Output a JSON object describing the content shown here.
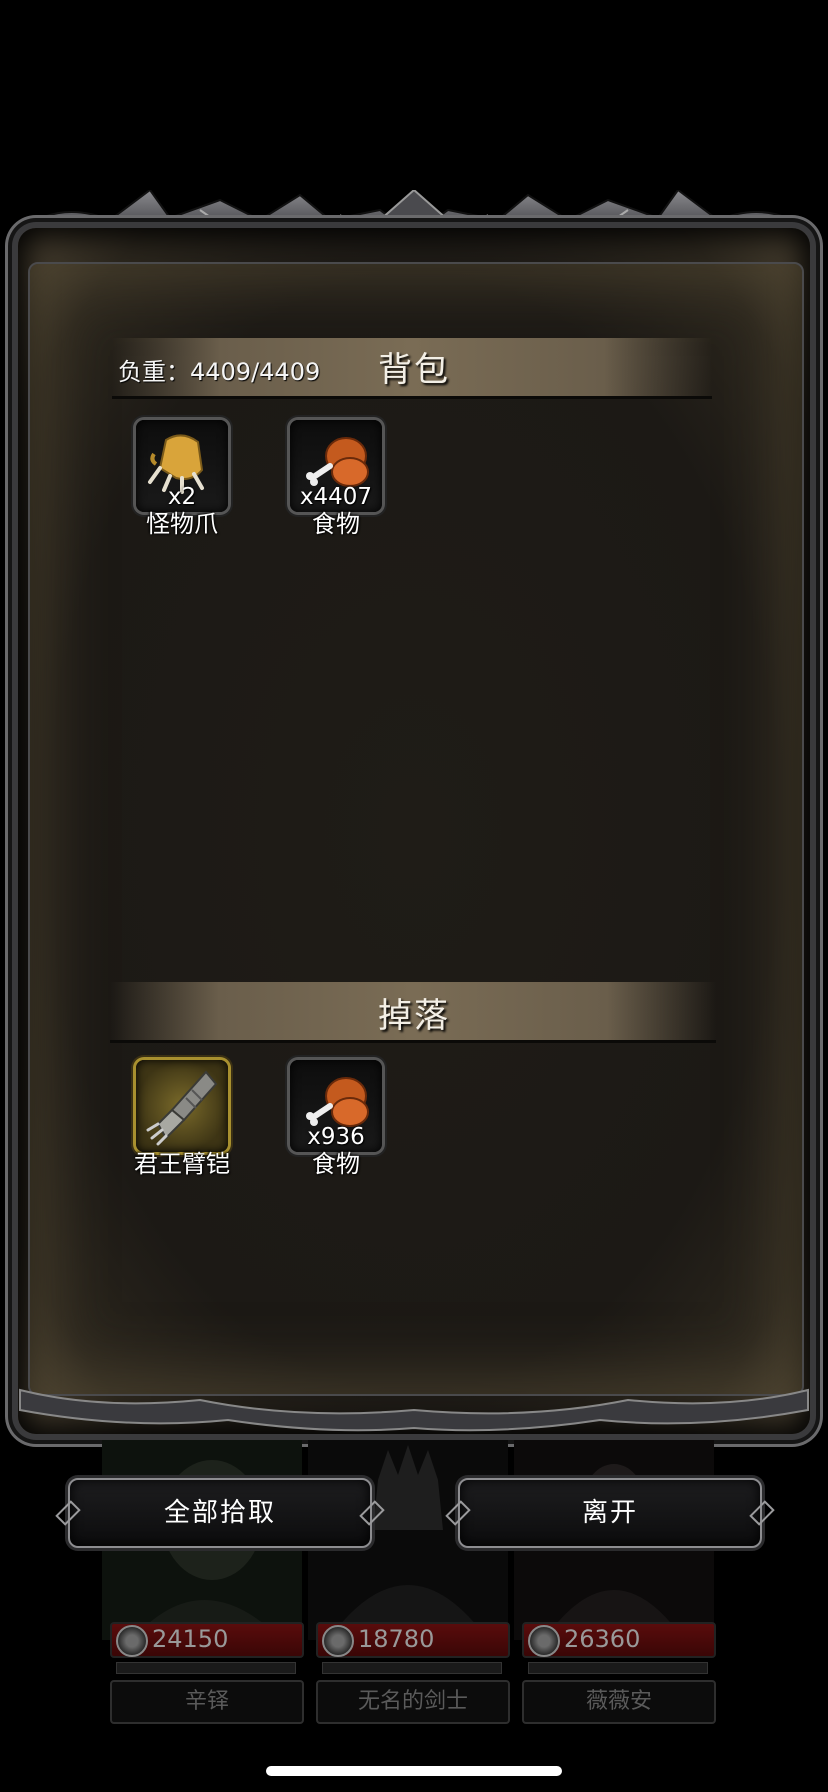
{
  "backpack": {
    "title": "背包",
    "weight_label": "负重：4409/4409",
    "items": [
      {
        "name": "怪物爪",
        "count": "x2",
        "icon": "monster-claw-icon"
      },
      {
        "name": "食物",
        "count": "x4407",
        "icon": "food-meat-icon"
      }
    ]
  },
  "loot": {
    "title": "掉落",
    "items": [
      {
        "name": "君王臂铠",
        "count": "",
        "icon": "gauntlet-icon",
        "rarity": "gold"
      },
      {
        "name": "食物",
        "count": "x936",
        "icon": "food-meat-icon"
      }
    ]
  },
  "buttons": {
    "pickup_all": "全部拾取",
    "leave": "离开"
  },
  "party": [
    {
      "name": "辛铎",
      "hp": "24150"
    },
    {
      "name": "无名的剑士",
      "hp": "18780"
    },
    {
      "name": "薇薇安",
      "hp": "26360"
    }
  ],
  "colors": {
    "frame_bg": "#1c1915",
    "section_bar": "#7a6c55",
    "hp_bar": "#5a0c0c",
    "gold_slot": "#a8902f"
  }
}
